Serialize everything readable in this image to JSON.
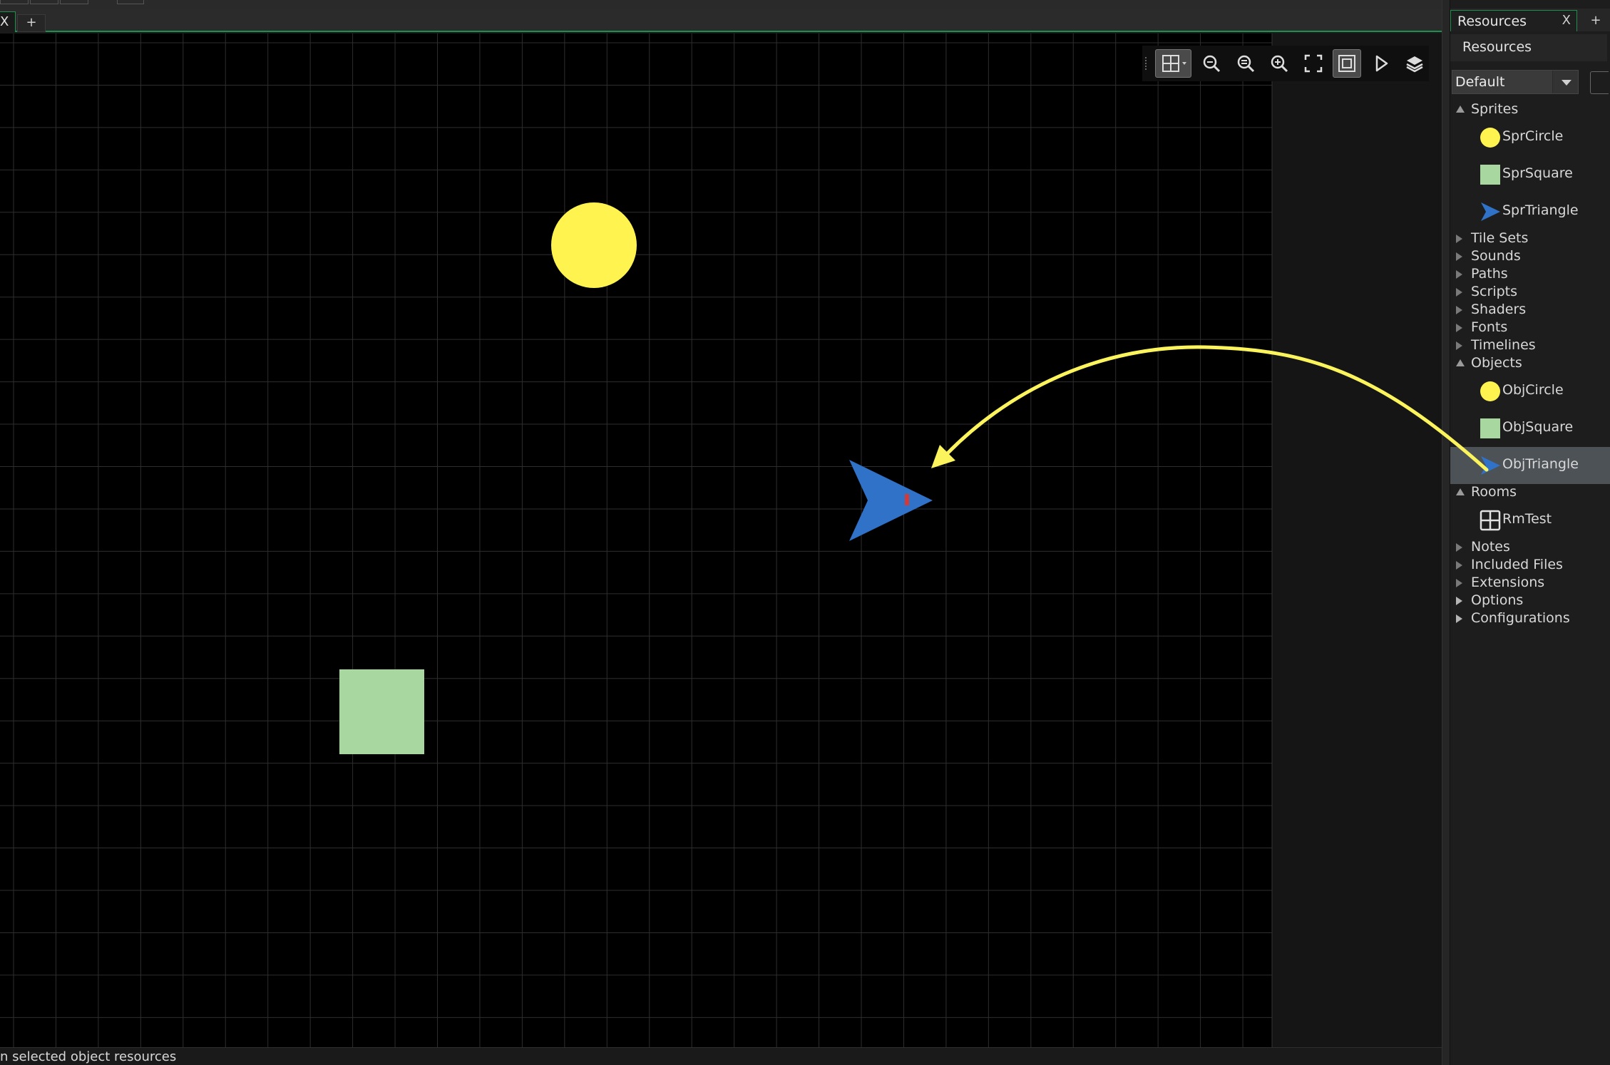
{
  "room_tab": {
    "close": "X",
    "add": "+"
  },
  "toolbar": {
    "items": [
      {
        "name": "grid-toggle-button",
        "icon": "grid-icon",
        "active": true
      },
      {
        "name": "zoom-out-button",
        "icon": "zoom-out-icon"
      },
      {
        "name": "zoom-reset-button",
        "icon": "zoom-reset-icon"
      },
      {
        "name": "zoom-in-button",
        "icon": "zoom-in-icon"
      },
      {
        "name": "fit-view-button",
        "icon": "fullscreen-icon"
      },
      {
        "name": "view-bounds-button",
        "icon": "frame-icon",
        "active": true
      },
      {
        "name": "run-button",
        "icon": "play-icon"
      },
      {
        "name": "layers-button",
        "icon": "layers-icon"
      }
    ]
  },
  "resources": {
    "tab_label": "Resources",
    "tab_close": "X",
    "tab_add": "+",
    "header": "Resources",
    "dropdown_value": "Default",
    "tree": [
      {
        "label": "Sprites",
        "type": "group",
        "state": "open"
      },
      {
        "label": "SprCircle",
        "type": "item",
        "icon": "circle"
      },
      {
        "label": "SprSquare",
        "type": "item",
        "icon": "square"
      },
      {
        "label": "SprTriangle",
        "type": "item",
        "icon": "triangle"
      },
      {
        "label": "Tile Sets",
        "type": "group",
        "state": "closed"
      },
      {
        "label": "Sounds",
        "type": "group",
        "state": "closed"
      },
      {
        "label": "Paths",
        "type": "group",
        "state": "closed"
      },
      {
        "label": "Scripts",
        "type": "group",
        "state": "closed"
      },
      {
        "label": "Shaders",
        "type": "group",
        "state": "closed"
      },
      {
        "label": "Fonts",
        "type": "group",
        "state": "closed"
      },
      {
        "label": "Timelines",
        "type": "group",
        "state": "closed"
      },
      {
        "label": "Objects",
        "type": "group",
        "state": "open"
      },
      {
        "label": "ObjCircle",
        "type": "item",
        "icon": "circle"
      },
      {
        "label": "ObjSquare",
        "type": "item",
        "icon": "square"
      },
      {
        "label": "ObjTriangle",
        "type": "item",
        "icon": "triangle",
        "selected": true
      },
      {
        "label": "Rooms",
        "type": "group",
        "state": "open"
      },
      {
        "label": "RmTest",
        "type": "item",
        "icon": "room"
      },
      {
        "label": "Notes",
        "type": "group",
        "state": "closed"
      },
      {
        "label": "Included Files",
        "type": "group",
        "state": "closed"
      },
      {
        "label": "Extensions",
        "type": "group",
        "state": "closed"
      },
      {
        "label": "Options",
        "type": "group",
        "state": "closed-solid"
      },
      {
        "label": "Configurations",
        "type": "group",
        "state": "closed-solid"
      }
    ]
  },
  "status": {
    "text": "n selected object resources"
  },
  "colors": {
    "circle": "#fff44f",
    "square": "#a8d8a0",
    "triangle": "#2f72c8",
    "triangle_mark": "#d23a3a",
    "grid_line": "#2e2e2e",
    "arrow": "#fbf45c",
    "accent": "#1e8f4e"
  }
}
